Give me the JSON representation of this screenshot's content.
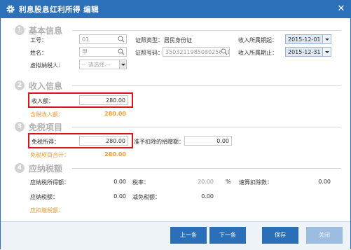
{
  "window": {
    "title": "利息股息红利所得 编辑",
    "icons": [
      "gear-icon",
      "close-icon"
    ],
    "accent": "#2b70b9"
  },
  "sections": {
    "basic": {
      "num": "1",
      "title": "基本信息"
    },
    "income": {
      "num": "2",
      "title": "收入信息"
    },
    "exempt": {
      "num": "3",
      "title": "免税项目"
    },
    "tax": {
      "num": "4",
      "title": "应纳税额"
    }
  },
  "basic": {
    "employee_id_label": "工号：",
    "employee_id_value": "01",
    "name_label": "姓名：",
    "name_value": "甲",
    "withholding_agent_label": "虚拟纳税人：",
    "withholding_agent_value": "-- 请选择 --",
    "id_type_label": "证照类型：",
    "id_type_value": "居民身份证",
    "id_number_label": "证照号码：",
    "id_number_value": "350321198508025628",
    "period_start_label": "收入所属期起：",
    "period_start_value": "2015-12-01",
    "period_end_label": "收入所属期止：",
    "period_end_value": "2015-12-31"
  },
  "income": {
    "amount_label": "收入额：",
    "amount_value": "280.00",
    "taxable_label": "含税收入额：",
    "taxable_value": "280.00"
  },
  "exempt": {
    "exempt_income_label": "免税所得：",
    "exempt_income_value": "280.00",
    "donation_label": "准予扣除的捐赠额：",
    "donation_value": "0.00",
    "total_label": "免税项目合计：",
    "total_value": "280.00"
  },
  "tax": {
    "taxable_income_label": "应纳税所得额：",
    "taxable_income_value": "0.00",
    "rate_label": "税率：",
    "rate_value": "20.00",
    "rate_unit": "%",
    "quick_deduction_label": "速算扣除数：",
    "quick_deduction_value": "0.00",
    "payable_label": "应纳税额：",
    "payable_value": "0.00",
    "relief_label": "减免税额：",
    "relief_value": "0.00",
    "withheld_label": "应扣缴税额："
  },
  "footer": {
    "prev": "上一条",
    "next": "下一条",
    "save": "保存",
    "close": "关闭"
  }
}
